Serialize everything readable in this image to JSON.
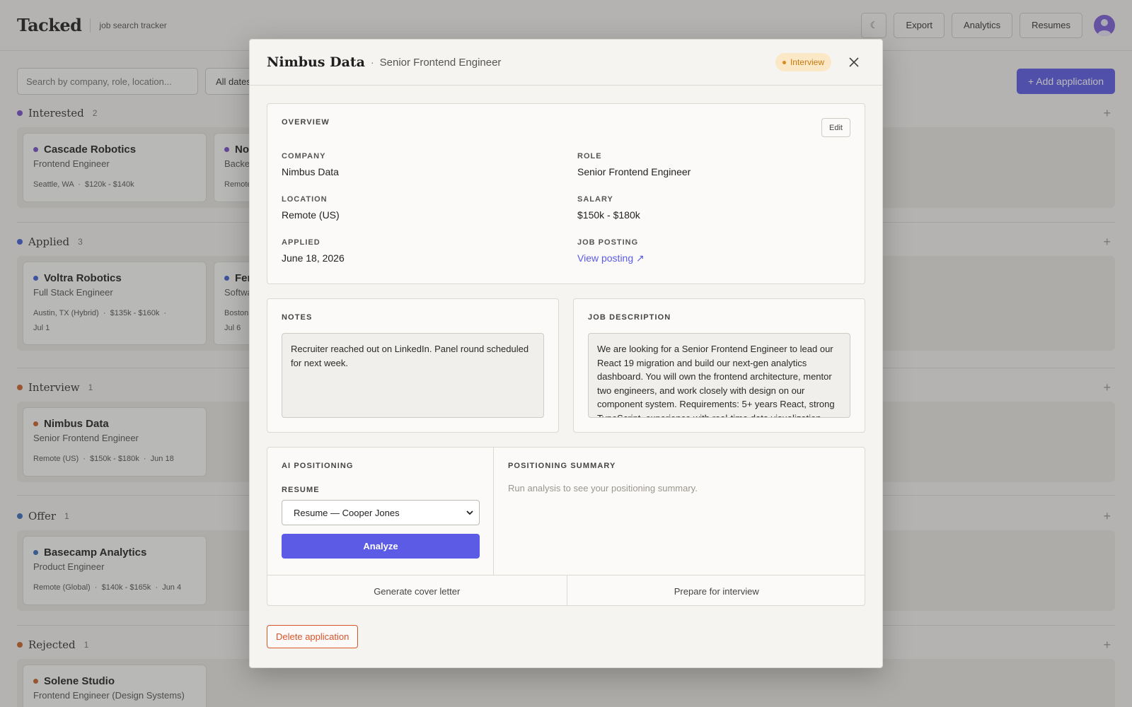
{
  "app": {
    "brand": "Tacked",
    "tagline": "job search tracker"
  },
  "topbar": {
    "theme_icon": "moon-icon",
    "export_label": "Export",
    "analytics_label": "Analytics",
    "resumes_label": "Resumes"
  },
  "filters": {
    "search_placeholder": "Search by company, role, location...",
    "date_label": "All dates"
  },
  "add_button": "+ Add application",
  "lanes": [
    {
      "title": "Interested",
      "count": "2",
      "color": "#7a4fc9",
      "cards": [
        {
          "company": "Cascade Robotics",
          "role": "Frontend Engineer",
          "meta": "Seattle, WA  ·  $120k - $140k"
        },
        {
          "company": "No",
          "role": "Backe",
          "meta": "Remote"
        }
      ]
    },
    {
      "title": "Applied",
      "count": "3",
      "color": "#3f5fd6",
      "cards": [
        {
          "company": "Voltra Robotics",
          "role": "Full Stack Engineer",
          "meta": "Austin, TX (Hybrid)  ·  $135k - $160k  ·",
          "meta2": "Jul 1"
        },
        {
          "company": "Fer",
          "role": "Softwa",
          "meta": "Boston",
          "meta2": "Jul 6"
        }
      ]
    },
    {
      "title": "Interview",
      "count": "1",
      "color": "#c8652a",
      "cards": [
        {
          "company": "Nimbus Data",
          "role": "Senior Frontend Engineer",
          "meta": "Remote (US)  ·  $150k - $180k  ·  Jun 18"
        }
      ]
    },
    {
      "title": "Offer",
      "count": "1",
      "color": "#3a6fb8",
      "cards": [
        {
          "company": "Basecamp Analytics",
          "role": "Product Engineer",
          "meta": "Remote (Global)  ·  $140k - $165k  ·  Jun 4"
        }
      ]
    },
    {
      "title": "Rejected",
      "count": "1",
      "color": "#c8652a",
      "cards": [
        {
          "company": "Solene Studio",
          "role": "Frontend Engineer (Design Systems)",
          "meta": ""
        }
      ]
    }
  ],
  "modal": {
    "company": "Nimbus Data",
    "separator": "·",
    "role": "Senior Frontend Engineer",
    "status": "Interview",
    "overview": {
      "label": "Overview",
      "edit_label": "Edit",
      "fields": [
        {
          "label": "COMPANY",
          "value": "Nimbus Data"
        },
        {
          "label": "ROLE",
          "value": "Senior Frontend Engineer"
        },
        {
          "label": "LOCATION",
          "value": "Remote (US)"
        },
        {
          "label": "SALARY",
          "value": "$150k - $180k"
        },
        {
          "label": "APPLIED",
          "value": "June 18, 2026"
        },
        {
          "label": "JOB POSTING",
          "value": "View posting ↗"
        }
      ]
    },
    "notes": {
      "label": "Notes",
      "text": "Recruiter reached out on LinkedIn. Panel round scheduled for next week."
    },
    "job_description": {
      "label": "Job Description",
      "text": "We are looking for a Senior Frontend Engineer to lead our React 19 migration and build our next-gen analytics dashboard. You will own the frontend architecture, mentor two engineers, and work closely with design on our component system. Requirements: 5+ years React, strong TypeScript, experience with real-time data visualization, and"
    },
    "ai": {
      "label": "AI Positioning",
      "resume_label": "Resume",
      "resume_selected": "Resume — Cooper Jones",
      "analyze_label": "Analyze",
      "summary_label": "Positioning Summary",
      "summary_empty": "Run analysis to see your positioning summary.",
      "cover_letter_label": "Generate cover letter",
      "interview_label": "Prepare for interview"
    },
    "delete_label": "Delete application"
  }
}
